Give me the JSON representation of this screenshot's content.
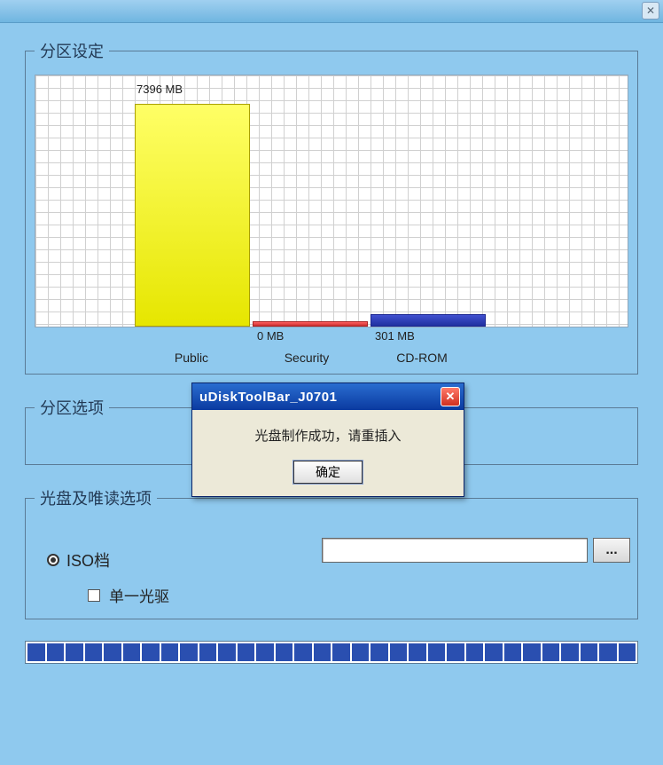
{
  "sections": {
    "partition_settings": "分区设定",
    "partition_options": "分区选项",
    "cdrom_options": "光盘及唯读选项"
  },
  "chart_data": {
    "type": "bar",
    "categories": [
      "Public",
      "Security",
      "CD-ROM"
    ],
    "values": [
      7396,
      0,
      301
    ],
    "value_labels": [
      "7396 MB",
      "0 MB",
      "301 MB"
    ],
    "ylabel": "MB",
    "ylim": [
      0,
      8000
    ]
  },
  "options": {
    "iso_radio": "ISO档",
    "single_drive": "单一光驱",
    "iso_path": "",
    "browse": "..."
  },
  "dialog": {
    "title": "uDiskToolBar_J0701",
    "message": "光盘制作成功，请重插入",
    "ok": "确定"
  }
}
